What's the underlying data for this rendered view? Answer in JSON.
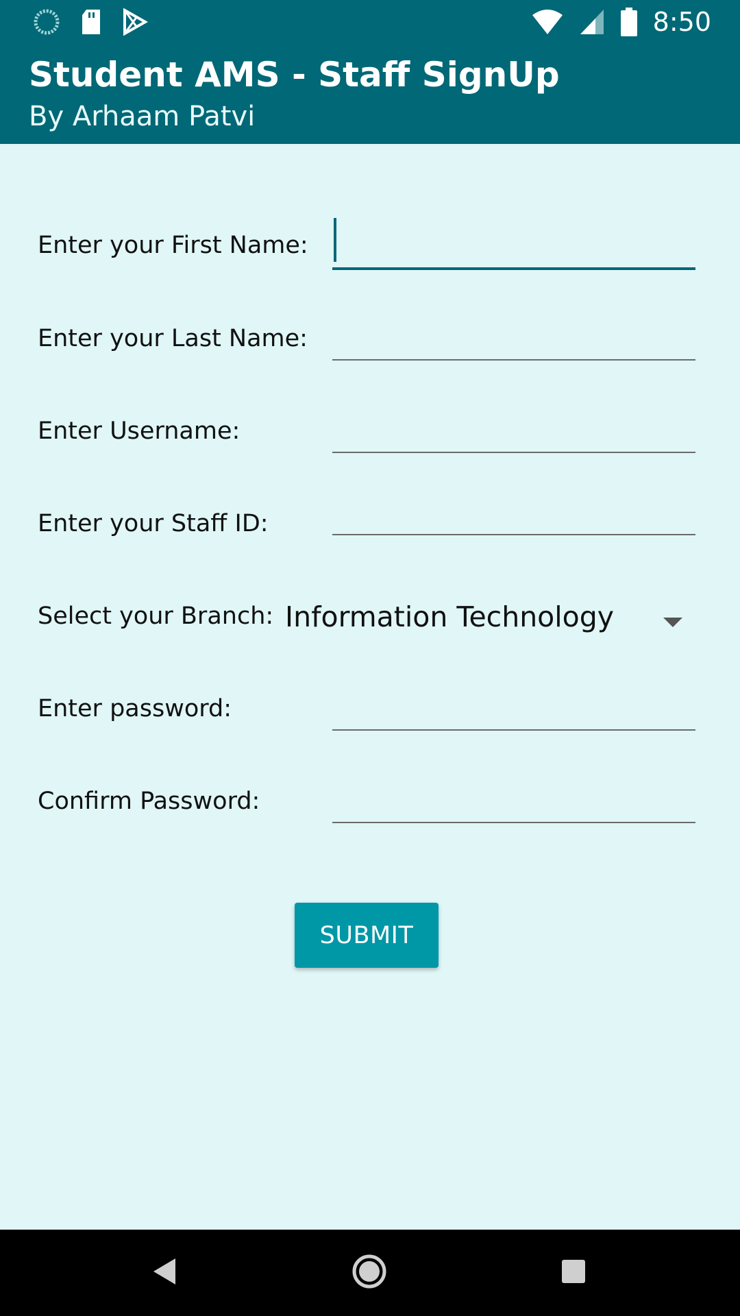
{
  "status_bar": {
    "time": "8:50",
    "left_icons": [
      "sync-icon",
      "sd-card-icon",
      "play-store-icon"
    ],
    "right_icons": [
      "wifi-icon",
      "signal-icon",
      "battery-icon"
    ]
  },
  "app_bar": {
    "title": "Student AMS - Staff SignUp",
    "subtitle": "By Arhaam Patvi",
    "color": "#006876"
  },
  "form": {
    "fields": [
      {
        "label": "Enter your First Name:",
        "value": ""
      },
      {
        "label": "Enter your Last Name:",
        "value": ""
      },
      {
        "label": "Enter Username:",
        "value": ""
      },
      {
        "label": "Enter your Staff ID:",
        "value": ""
      },
      {
        "label": "Select your Branch:",
        "value": "Information Technology"
      },
      {
        "label": "Enter password:",
        "value": ""
      },
      {
        "label": "Confirm Password:",
        "value": ""
      }
    ],
    "submit_label": "SUBMIT",
    "background": "#e0f6f7",
    "button_color": "#0097a7"
  },
  "nav_bar": {
    "icons": [
      "back-icon",
      "home-icon",
      "recents-icon"
    ]
  }
}
